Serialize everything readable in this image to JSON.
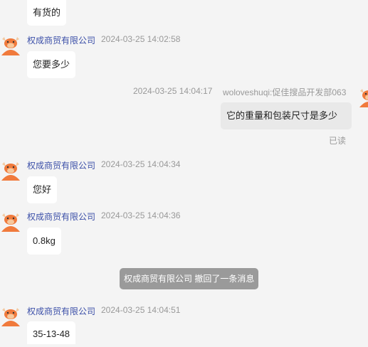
{
  "messages": [
    {
      "text": "有货的"
    },
    {
      "sender": "权成商贸有限公司",
      "time": "2024-03-25 14:02:58",
      "text": "您要多少"
    },
    {
      "sender": "woloveshuqi:促佳搜品开发部063",
      "time": "2024-03-25 14:04:17",
      "text": "它的重量和包装尺寸是多少",
      "status": "已读"
    },
    {
      "sender": "权成商贸有限公司",
      "time": "2024-03-25 14:04:34",
      "text": "您好"
    },
    {
      "sender": "权成商贸有限公司",
      "time": "2024-03-25 14:04:36",
      "text": "0.8kg"
    },
    {
      "sender": "权成商贸有限公司",
      "time": "2024-03-25 14:04:51",
      "text": "35-13-48"
    }
  ],
  "system": {
    "recall": "权成商贸有限公司 撤回了一条消息"
  },
  "icons": {
    "seller_avatar": "cow-avatar-icon",
    "buyer_avatar": "cow-avatar-icon"
  },
  "colors": {
    "background": "#f4f4f4",
    "sender_name": "#3b4fa8",
    "recall_bg": "#9a9a9a",
    "avatar": "#f07a3c"
  }
}
